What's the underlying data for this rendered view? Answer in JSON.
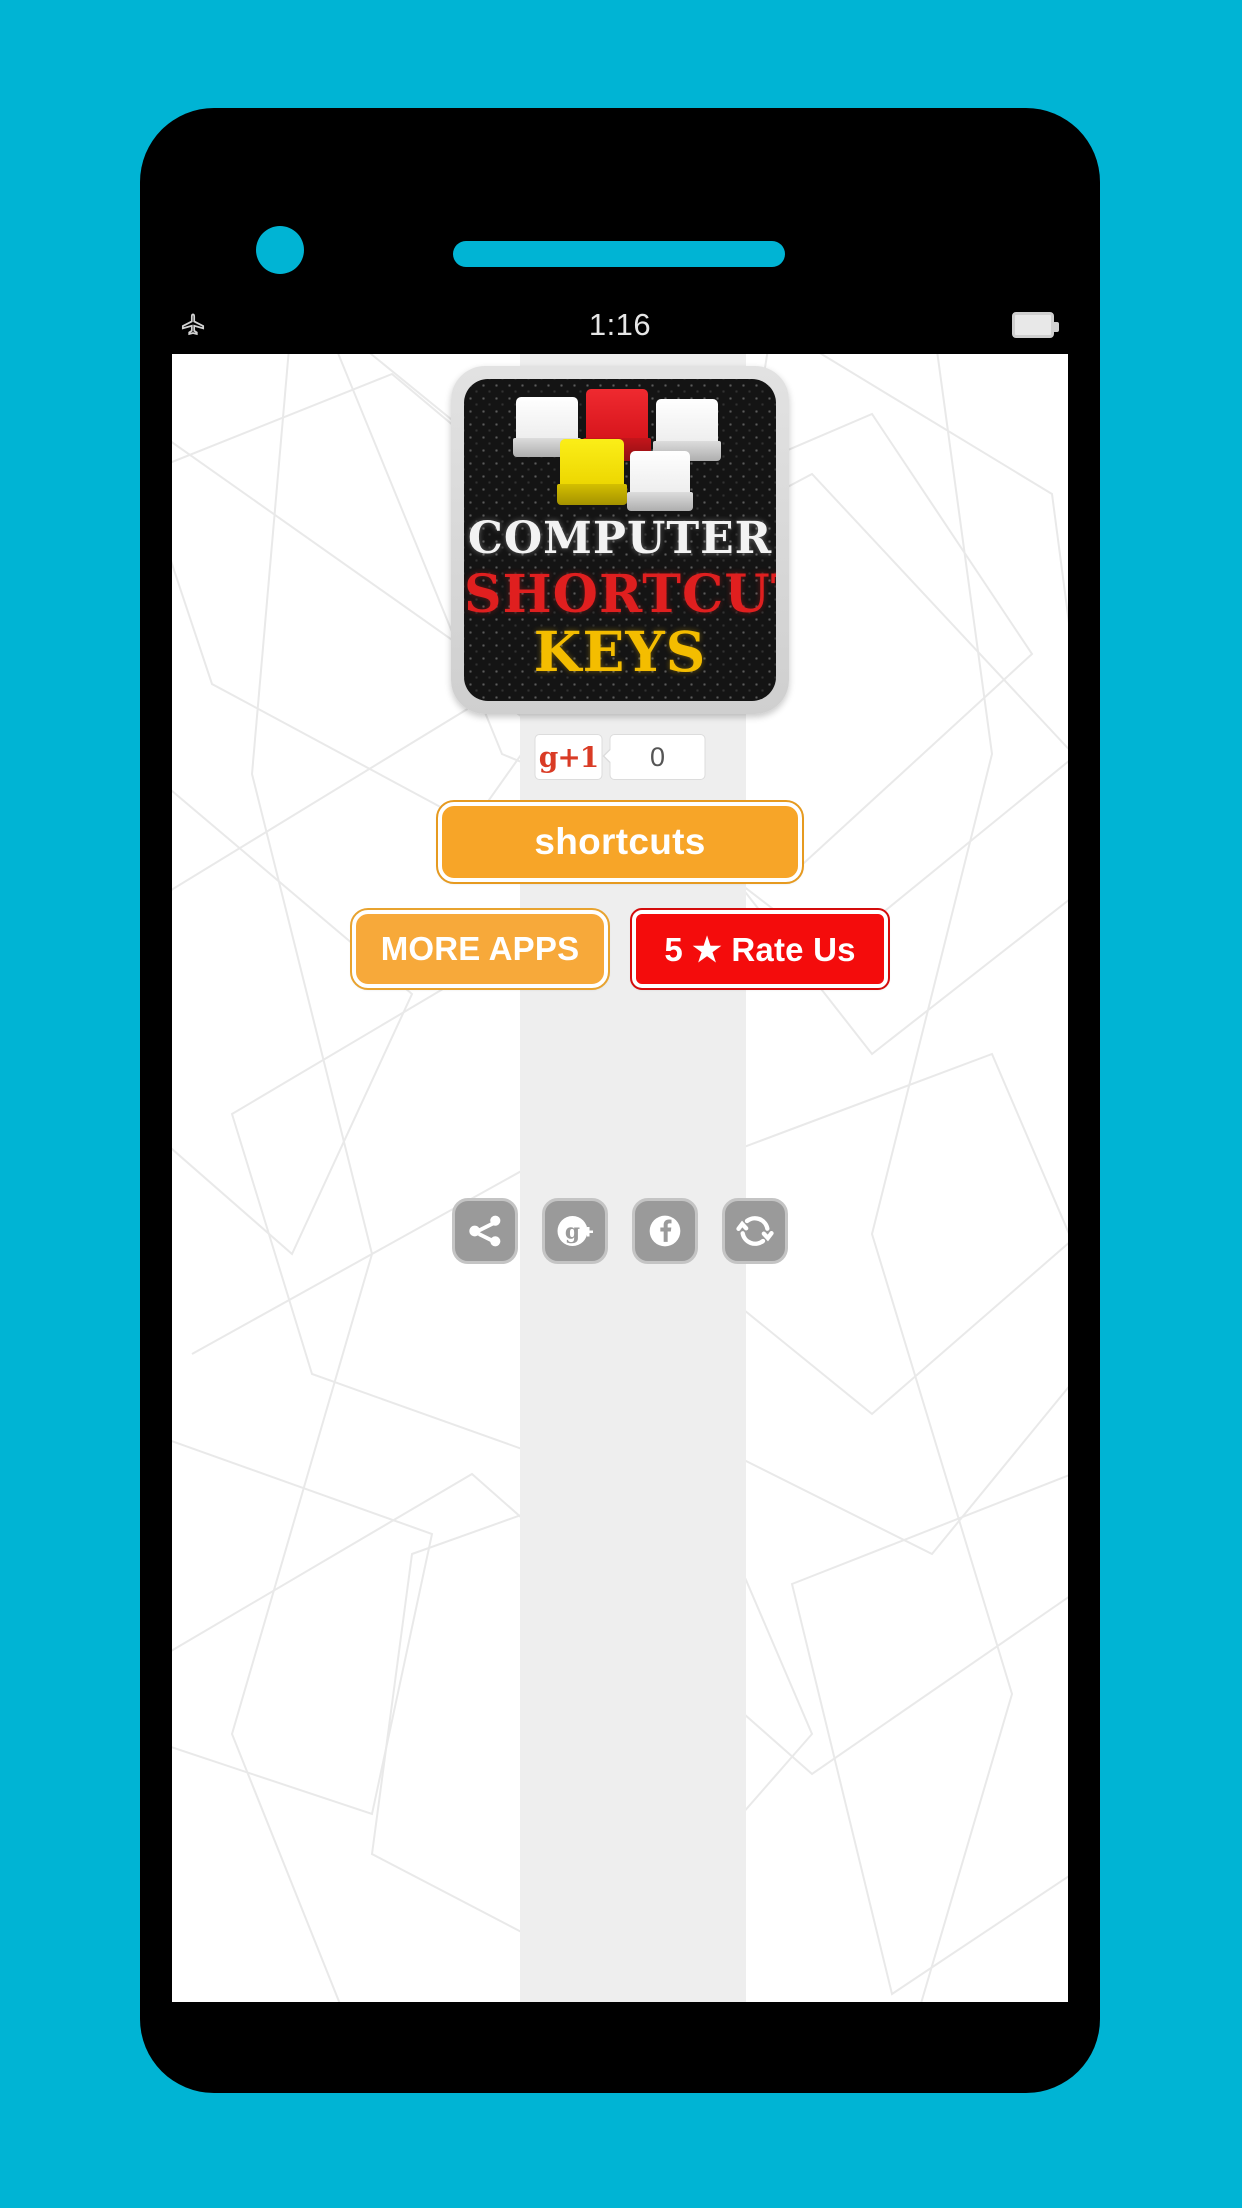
{
  "theme": {
    "page_background": "#00b4d4",
    "phone_body": "#000000",
    "screen_background": "#ffffff",
    "center_band": "#eeeeee",
    "accent_orange": "#f7a528",
    "accent_orange_light": "#f7a93a",
    "accent_red": "#f40c0c",
    "social_gray": "#9a9a9a",
    "social_border_gray": "#c4c4c4"
  },
  "status_bar": {
    "airplane_icon": "airplane-mode-icon",
    "time": "1:16",
    "battery_icon": "battery-icon"
  },
  "app_icon": {
    "line1": "COMPUTER",
    "line2": "SHORTCUT",
    "line3": "KEYS",
    "line1_color": "#f2f2f2",
    "line2_color": "#e01f1f",
    "line3_color": "#f4bd00",
    "background_color": "#141414",
    "keys": [
      {
        "name": "keycap-white-left",
        "color": "#ffffff",
        "base": "#b8b8b8"
      },
      {
        "name": "keycap-red",
        "color": "#e31b23",
        "base": "#a8141a"
      },
      {
        "name": "keycap-white-right",
        "color": "#ffffff",
        "base": "#b8b8b8"
      },
      {
        "name": "keycap-yellow",
        "color": "#f5e000",
        "base": "#c2b000"
      },
      {
        "name": "keycap-white-bottom",
        "color": "#ffffff",
        "base": "#b8b8b8"
      }
    ]
  },
  "gplus": {
    "label": "g+1",
    "count": "0"
  },
  "buttons": {
    "shortcuts": "shortcuts",
    "more_apps": "MORE APPS",
    "rate_us": "5 ★ Rate Us"
  },
  "social": [
    {
      "name": "share-icon",
      "label": "Share"
    },
    {
      "name": "google-plus-icon",
      "label": "Google Plus"
    },
    {
      "name": "facebook-icon",
      "label": "Facebook"
    },
    {
      "name": "refresh-icon",
      "label": "Refresh"
    }
  ]
}
